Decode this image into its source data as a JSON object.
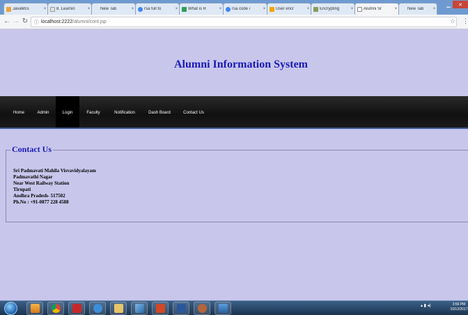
{
  "browser": {
    "tabs": [
      {
        "label": "JavaMcs",
        "color": "#e8a33d"
      },
      {
        "label": "8. Learnin",
        "color": "#cccccc"
      },
      {
        "label": "New Tab",
        "color": "#cccccc"
      },
      {
        "label": "rsa full fo",
        "color": "#4285f4"
      },
      {
        "label": "What is R",
        "color": "#2e9e5b"
      },
      {
        "label": "rsa code i",
        "color": "#4285f4"
      },
      {
        "label": "User encr",
        "color": "#f4a400"
      },
      {
        "label": "Encrypting",
        "color": "#8a9a5b"
      },
      {
        "label": "Alumni Sr",
        "color": "#cccccc"
      },
      {
        "label": "New Tab",
        "color": "#cccccc"
      }
    ],
    "url_host": "localhost:2222",
    "url_path": "/alumni/cont.jsp"
  },
  "page": {
    "site_title": "Alumni Information System",
    "nav": [
      {
        "label": "Home"
      },
      {
        "label": "Admin"
      },
      {
        "label": "Login"
      },
      {
        "label": "Faculty"
      },
      {
        "label": "Notification"
      },
      {
        "label": "Dash Board"
      },
      {
        "label": "Contact Us"
      }
    ],
    "contact": {
      "legend": "Contact Us",
      "line1": "Sri Padmavati Mahila Visvavidyalayam",
      "line2": "Padmavathi Nagar",
      "line3": "Near West Railway Station",
      "line4": "Tirupati",
      "line5": "Andhra Pradesh- 517502",
      "line6": "Ph.No : +91-0877 228 4588"
    }
  },
  "taskbar": {
    "time": "3:56 PM",
    "date": "10/12/2017"
  }
}
